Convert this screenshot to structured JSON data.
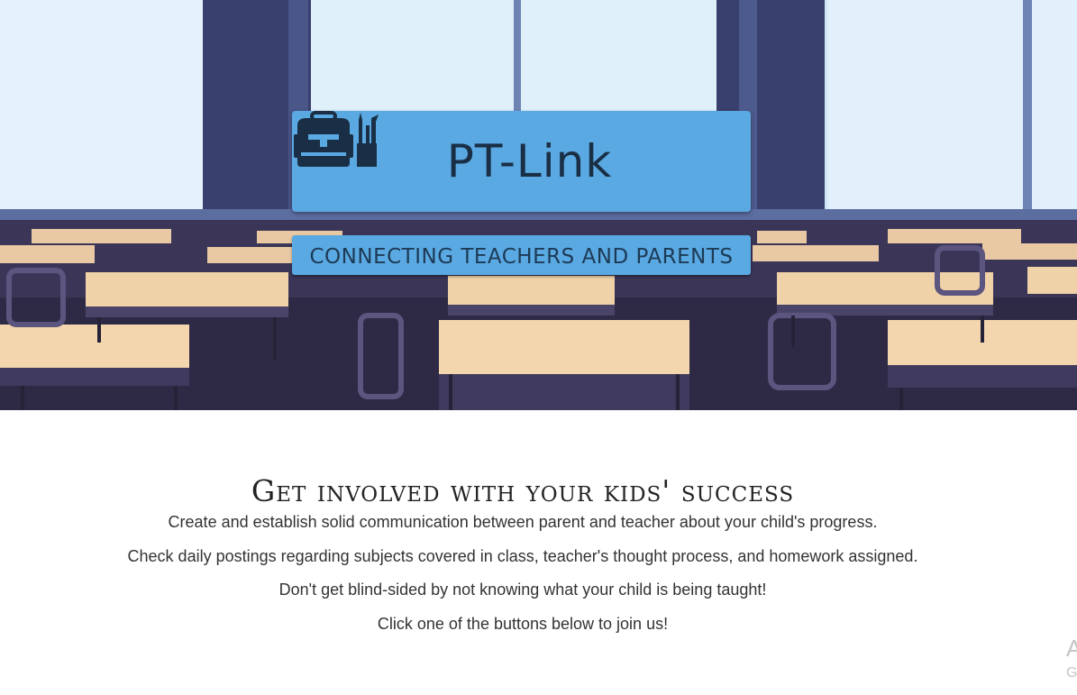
{
  "hero": {
    "brand_name": "PT-Link",
    "brand_icon": "backpack-and-pencil-cup-icon",
    "tagline": "CONNECTING TEACHERS AND PARENTS",
    "colors": {
      "brand_box": "#5aa9e2",
      "brand_text": "#1a2f45"
    }
  },
  "main": {
    "headline": "Get involved with your kids' success",
    "paragraphs": [
      "Create and establish solid communication between parent and teacher about your child's progress.",
      "Check daily postings regarding subjects covered in class, teacher's thought process, and homework assigned.",
      "Don't get blind-sided by not knowing what your child is being taught!",
      "Click one of the buttons below to join us!"
    ]
  },
  "edge": {
    "char_1": "A",
    "char_2": "G"
  }
}
